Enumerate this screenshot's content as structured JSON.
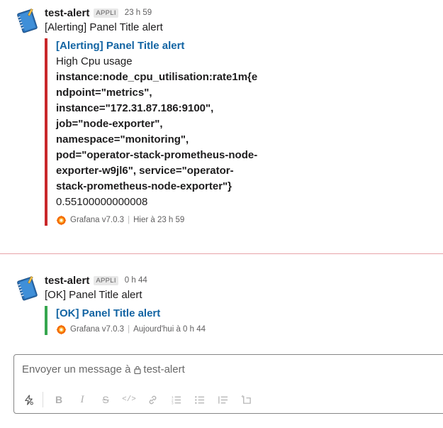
{
  "messages": [
    {
      "sender": "test-alert",
      "badge": "APPLI",
      "time": "23 h 59",
      "text": "[Alerting] Panel Title alert",
      "attachment": {
        "status": "alerting",
        "color": "#c9282a",
        "title": "[Alerting] Panel Title alert",
        "description": "High Cpu usage",
        "metric": "instance:node_cpu_utilisation:rate1m{endpoint=\"metrics\", instance=\"172.31.87.186:9100\", job=\"node-exporter\", namespace=\"monitoring\", pod=\"operator-stack-prometheus-node-exporter-w9jl6\", service=\"operator-stack-prometheus-node-exporter\"}",
        "value": "0.55100000000008",
        "footer_source": "Grafana v7.0.3",
        "footer_time": "Hier à 23 h 59"
      }
    },
    {
      "sender": "test-alert",
      "badge": "APPLI",
      "time": "0 h 44",
      "text": "[OK] Panel Title alert",
      "attachment": {
        "status": "ok",
        "color": "#36a64f",
        "title": "[OK] Panel Title alert",
        "footer_source": "Grafana v7.0.3",
        "footer_time": "Aujourd'hui à 0 h 44"
      }
    }
  ],
  "composer": {
    "placeholder_prefix": "Envoyer un message à",
    "channel": "test-alert",
    "toolbar": [
      "shortcuts-icon",
      "bold-icon",
      "italic-icon",
      "strikethrough-icon",
      "code-icon",
      "link-icon",
      "ordered-list-icon",
      "bulleted-list-icon",
      "blockquote-icon",
      "code-block-icon"
    ]
  }
}
